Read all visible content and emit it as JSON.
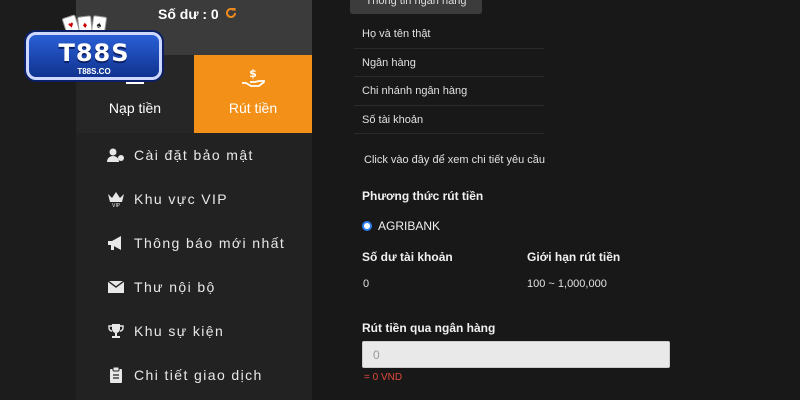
{
  "header": {
    "balance_label": "Số dư : 0",
    "refresh_icon": "refresh-icon"
  },
  "logo": {
    "text": "T88S",
    "sub": "T88S.CO"
  },
  "tabs": [
    {
      "label": "Nạp tiền",
      "icon": "deposit-icon",
      "active": false
    },
    {
      "label": "Rút tiền",
      "icon": "withdraw-icon",
      "active": true
    }
  ],
  "menu": [
    {
      "label": "Cài đặt bảo mật",
      "icon": "security-user-icon"
    },
    {
      "label": "Khu vực VIP",
      "icon": "vip-crown-icon"
    },
    {
      "label": "Thông báo mới nhất",
      "icon": "megaphone-icon"
    },
    {
      "label": "Thư nội bộ",
      "icon": "envelope-icon"
    },
    {
      "label": "Khu sự kiện",
      "icon": "trophy-icon"
    },
    {
      "label": "Chi tiết giao dịch",
      "icon": "clipboard-icon"
    }
  ],
  "bank_tab": "Thông tin ngân hàng",
  "bank_info": [
    "Họ và tên thật",
    "Ngân hàng",
    "Chi nhánh ngân hàng",
    "Số tài khoản"
  ],
  "detail_link": "Click vào đây để xem chi tiết yêu cầu",
  "withdraw_method": {
    "title": "Phương thức rút tiền",
    "option": "AGRIBANK",
    "selected": true
  },
  "account": {
    "balance_title": "Số dư tài khoản",
    "balance_value": "0",
    "limit_title": "Giới hạn rút tiền",
    "limit_value": "100 ~ 1,000,000"
  },
  "bank_withdraw": {
    "title": "Rút tiền qua ngân hàng",
    "placeholder": "0",
    "note": "= 0 VND"
  },
  "colors": {
    "accent": "#f39018",
    "sidebar_bg": "#222222",
    "main_bg": "#181818",
    "note_red": "#e04a3a",
    "radio_blue": "#2d7ff0"
  }
}
